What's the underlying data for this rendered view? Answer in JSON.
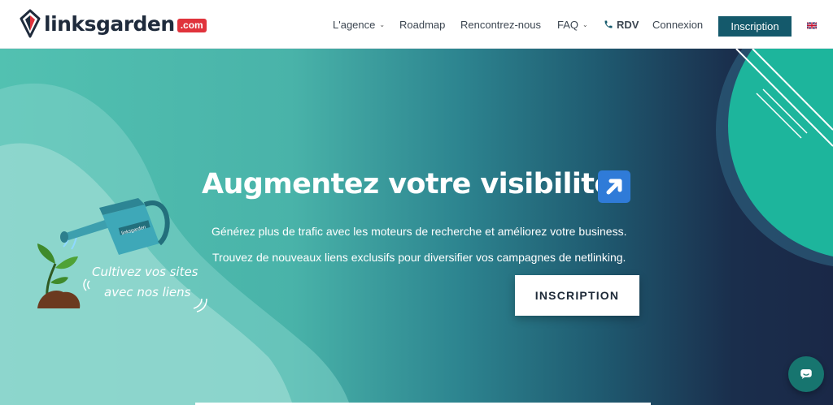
{
  "brand": {
    "name": "linksgarden",
    "tld": ".com",
    "accent_color": "#e0333c",
    "primary_color": "#14596b"
  },
  "nav": {
    "items": [
      {
        "label": "L'agence",
        "has_dropdown": true
      },
      {
        "label": "Roadmap",
        "has_dropdown": false
      },
      {
        "label": "Rencontrez-nous",
        "has_dropdown": false
      },
      {
        "label": "FAQ",
        "has_dropdown": true
      },
      {
        "label": "RDV",
        "icon": "phone-icon"
      },
      {
        "label": "Connexion",
        "has_dropdown": false
      }
    ],
    "cta_label": "Inscription",
    "language_icon": "uk-flag-icon"
  },
  "hero": {
    "title": "Augmentez votre visibilité",
    "title_icon": "arrow-up-right-icon",
    "subtitle_1": "Générez plus de trafic avec les moteurs de recherche et améliorez votre business.",
    "subtitle_2": "Trouvez de nouveaux liens exclusifs pour diversifier vos campagnes de netlinking.",
    "cta_label": "INSCRIPTION",
    "tagline_1": "Cultivez vos sites",
    "tagline_2": "avec nos liens",
    "watering_can_text": "linksgarden"
  },
  "chat": {
    "icon": "chat-bubble-icon",
    "color": "#17756f"
  }
}
